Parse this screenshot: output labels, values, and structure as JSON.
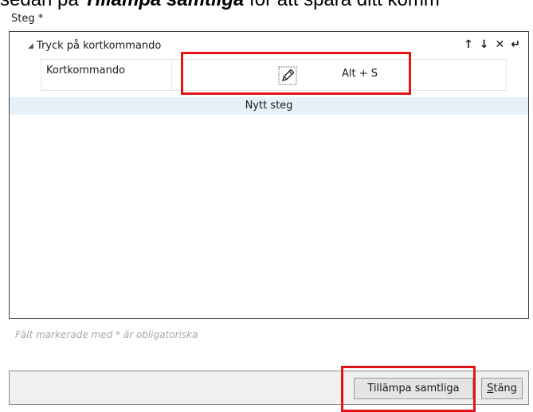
{
  "instruction": {
    "before": "sedan på ",
    "emphasis": "Tillämpa samtliga",
    "after": " för att spara ditt komm"
  },
  "steps": {
    "label": "Steg *",
    "step": {
      "title": "Tryck på kortkommando",
      "param_name": "Kortkommando",
      "param_value": "Alt + S"
    },
    "new_step_label": "Nytt steg"
  },
  "required_note": "Fält markerade med * är obligatoriska",
  "footer": {
    "apply_label": "Tillämpa samtliga",
    "close_first_letter": "S",
    "close_rest": "täng"
  },
  "icons": [
    "expand-triangle-icon",
    "move-up-icon",
    "move-down-icon",
    "delete-icon",
    "indent-icon",
    "edit-pencil-icon"
  ],
  "colors": {
    "highlight": "#e3141a",
    "new_step_background": "#e7f1fa",
    "footer_background": "#f0f0f0"
  }
}
